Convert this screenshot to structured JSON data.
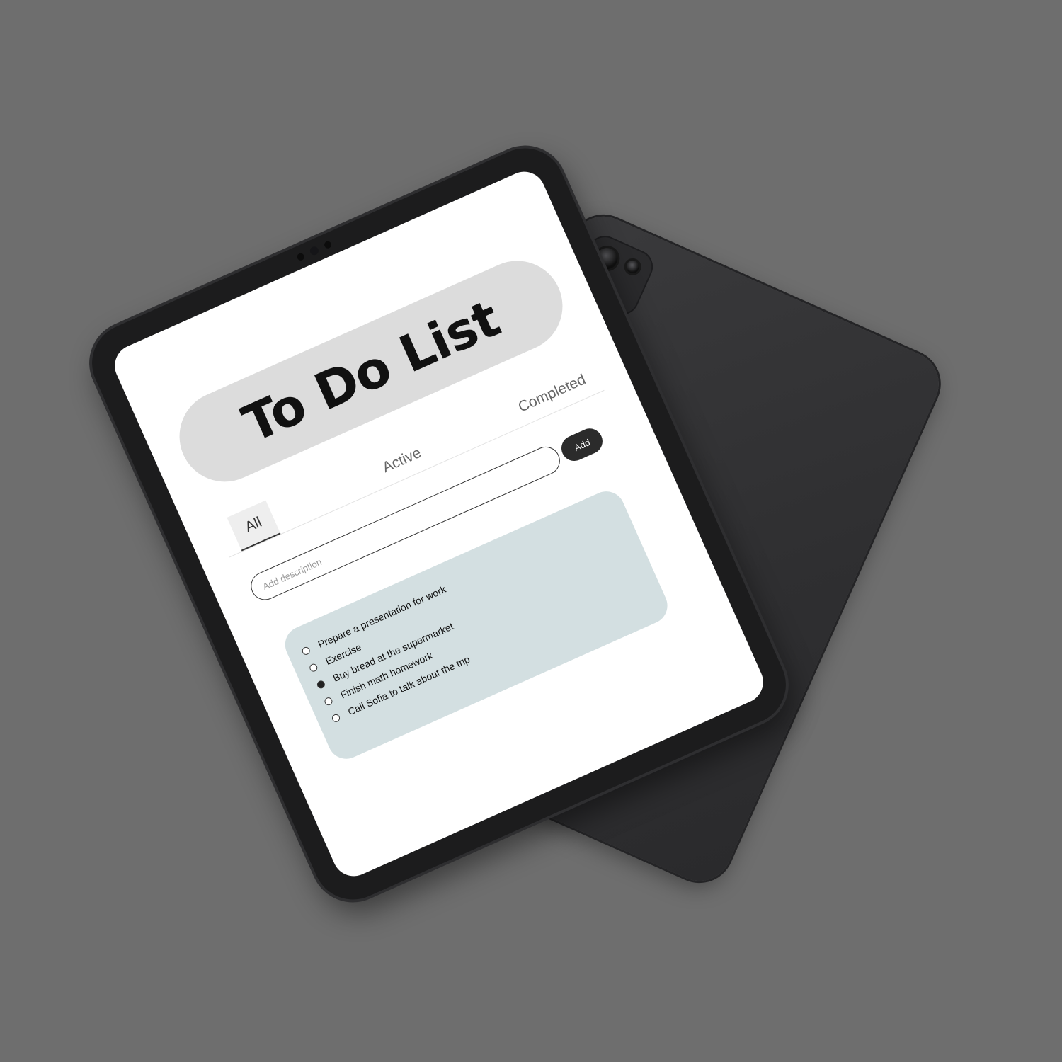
{
  "app": {
    "title": "To Do List"
  },
  "tabs": {
    "all": "All",
    "active": "Active",
    "completed": "Completed",
    "selected": "All"
  },
  "input": {
    "placeholder": "Add description",
    "value": "",
    "add_label": "Add"
  },
  "tasks": [
    {
      "text": "Prepare a presentation for work",
      "done": false
    },
    {
      "text": "Exercise",
      "done": false
    },
    {
      "text": "Buy bread at the supermarket",
      "done": true
    },
    {
      "text": "Finish math homework",
      "done": false
    },
    {
      "text": "Call Sofia to talk about the trip",
      "done": false
    }
  ],
  "colors": {
    "background": "#6e6e6e",
    "tablet_body": "#1c1c1d",
    "tablet_back": "#333335",
    "screen": "#ffffff",
    "title_pill": "#dcdcdc",
    "task_panel": "#d3dfe1",
    "add_button": "#2b2b2b"
  }
}
